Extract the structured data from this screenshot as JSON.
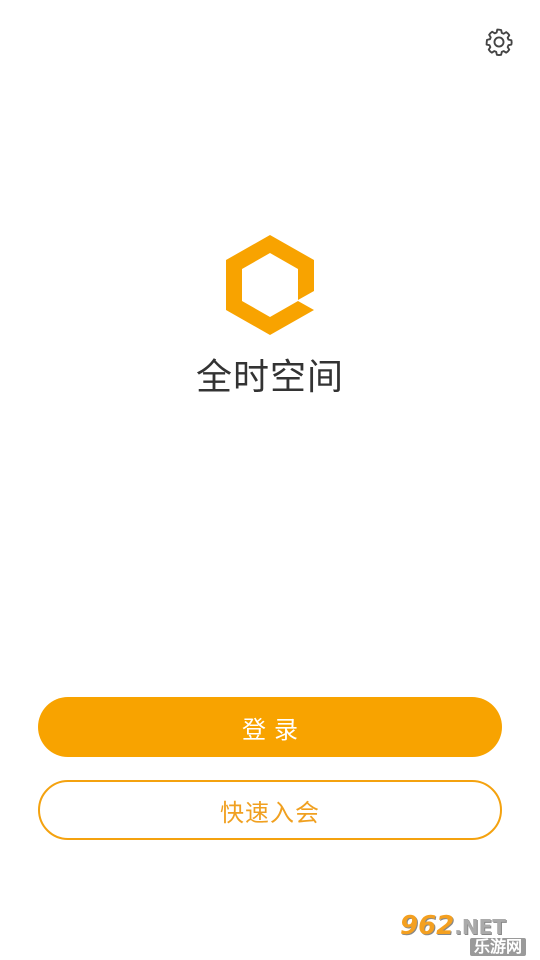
{
  "header": {
    "settings_icon": "gear-icon"
  },
  "brand": {
    "logo_icon": "hexagon-logo-icon",
    "app_name": "全时空间",
    "accent_color": "#f8a300"
  },
  "actions": {
    "login_label": "登录",
    "join_label": "快速入会"
  },
  "watermark": {
    "site_number": "962",
    "site_suffix": ".NET",
    "site_name": "乐游网"
  }
}
